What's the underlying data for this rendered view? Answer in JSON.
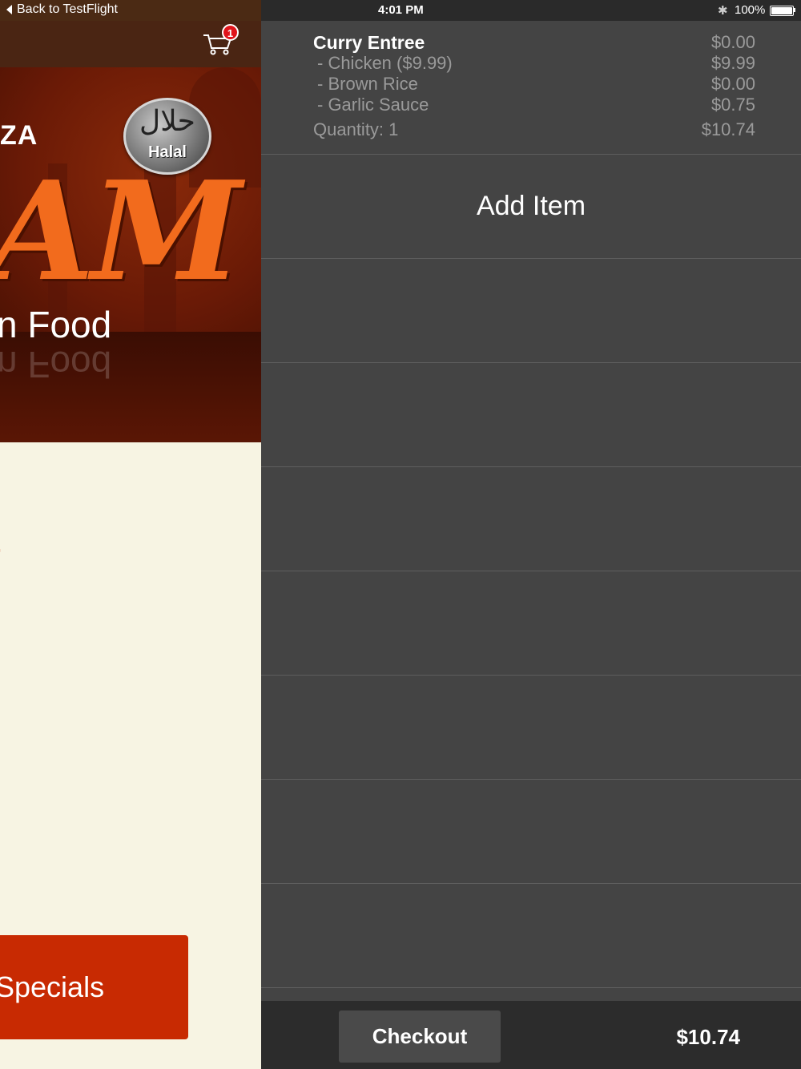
{
  "status_bar": {
    "back_label": "Back to TestFlight",
    "time": "4:01 PM",
    "battery_percent": "100%",
    "bluetooth_icon": "bluetooth-icon"
  },
  "background_app": {
    "cart_badge_count": "1",
    "banner": {
      "partial_text_top": "ZA",
      "partial_text_big": "AM",
      "partial_text_food": "n Food",
      "halal_arabic": "حلال",
      "halal_label": "Halal"
    },
    "red_fragment": "t",
    "specials_button_label": "Specials"
  },
  "cart": {
    "item": {
      "name": "Curry Entree",
      "base_price": "$0.00",
      "modifiers": [
        {
          "label": "- Chicken ($9.99)",
          "price": "$9.99"
        },
        {
          "label": "- Brown Rice",
          "price": "$0.00"
        },
        {
          "label": "- Garlic Sauce",
          "price": "$0.75"
        }
      ],
      "quantity_label": "Quantity: 1",
      "line_total": "$10.74"
    },
    "add_item_label": "Add Item",
    "checkout_label": "Checkout",
    "total": "$10.74"
  },
  "colors": {
    "accent_red": "#c82a02",
    "banner_orange": "#f26b1d",
    "drawer_bg": "#444444",
    "bottom_bar_bg": "#2c2c2c"
  }
}
